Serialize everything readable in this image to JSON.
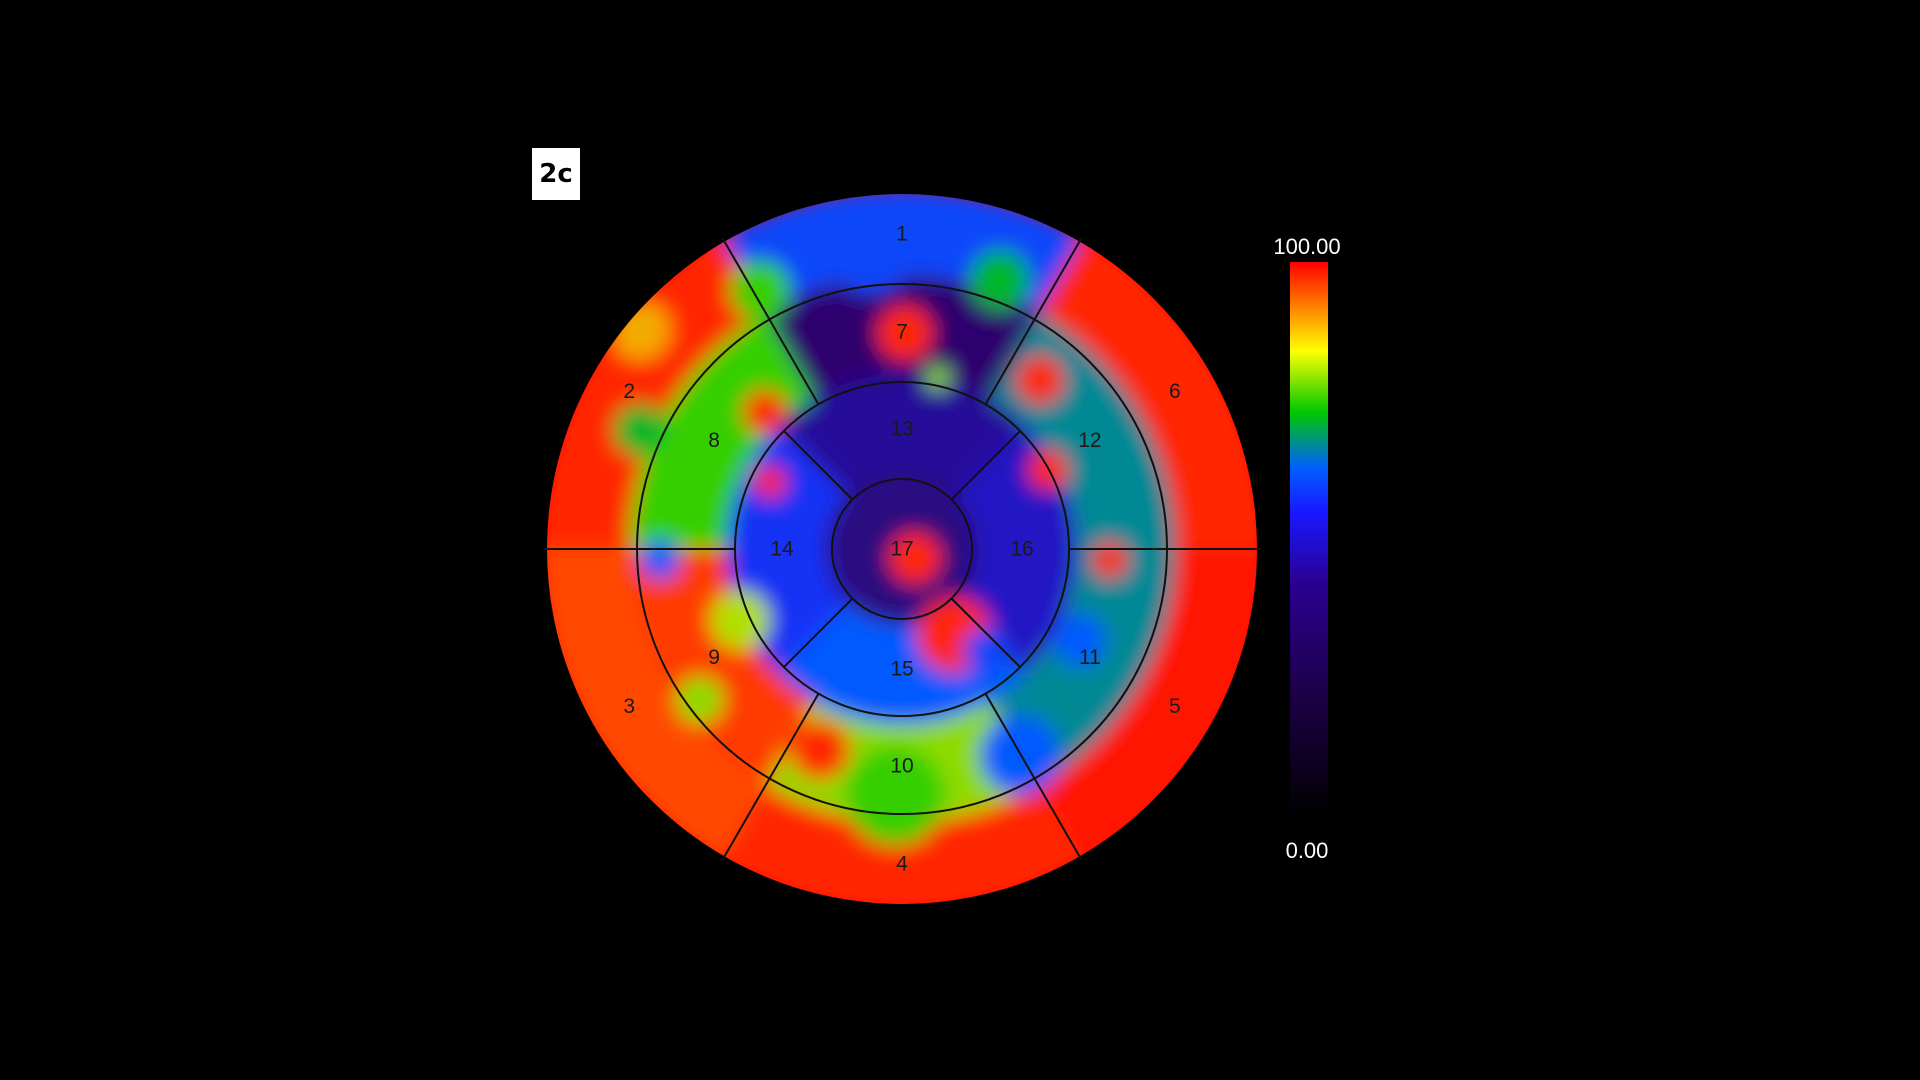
{
  "panel_label": "2c",
  "colorbar": {
    "max_label": "100.00",
    "min_label": "0.00",
    "colors": [
      "#ff0000",
      "#ff8000",
      "#ffff00",
      "#00c800",
      "#0040ff",
      "#2a0070",
      "#000000"
    ]
  },
  "segments": [
    {
      "id": 1,
      "label": "1",
      "level": 0.45
    },
    {
      "id": 2,
      "label": "2",
      "level": 0.95
    },
    {
      "id": 3,
      "label": "3",
      "level": 0.9
    },
    {
      "id": 4,
      "label": "4",
      "level": 0.95
    },
    {
      "id": 5,
      "label": "5",
      "level": 0.97
    },
    {
      "id": 6,
      "label": "6",
      "level": 0.95
    },
    {
      "id": 7,
      "label": "7",
      "level": 0.2
    },
    {
      "id": 8,
      "label": "8",
      "level": 0.65
    },
    {
      "id": 9,
      "label": "9",
      "level": 0.92
    },
    {
      "id": 10,
      "label": "10",
      "level": 0.7
    },
    {
      "id": 11,
      "label": "11",
      "level": 0.55
    },
    {
      "id": 12,
      "label": "12",
      "level": 0.55
    },
    {
      "id": 13,
      "label": "13",
      "level": 0.25
    },
    {
      "id": 14,
      "label": "14",
      "level": 0.4
    },
    {
      "id": 15,
      "label": "15",
      "level": 0.5
    },
    {
      "id": 16,
      "label": "16",
      "level": 0.3
    },
    {
      "id": 17,
      "label": "17",
      "level": 0.22
    }
  ]
}
